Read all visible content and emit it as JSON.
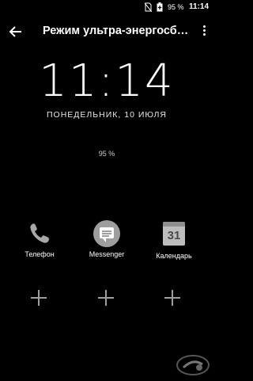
{
  "status_bar": {
    "battery_percent": "95 %",
    "time": "11:14",
    "icons": [
      "no-sim-icon",
      "battery-icon"
    ]
  },
  "app_bar": {
    "title": "Режим ультра-энергосб…",
    "back_icon": "arrow-back-icon",
    "menu_icon": "more-vert-icon"
  },
  "lock": {
    "clock": "11:14",
    "date": "ПОНЕДЕЛЬНИК, 10 ИЮЛЯ",
    "battery": "95 %"
  },
  "apps": [
    {
      "label": "Телефон",
      "icon": "phone-icon"
    },
    {
      "label": "Messenger",
      "icon": "messenger-icon"
    },
    {
      "label": "Календарь",
      "icon": "calendar-icon",
      "day": "31"
    }
  ],
  "slots": [
    "add-app-icon",
    "add-app-icon",
    "add-app-icon"
  ],
  "colors": {
    "background": "#000000",
    "text": "#ffffff",
    "icon_gray": "#9e9e9e"
  }
}
